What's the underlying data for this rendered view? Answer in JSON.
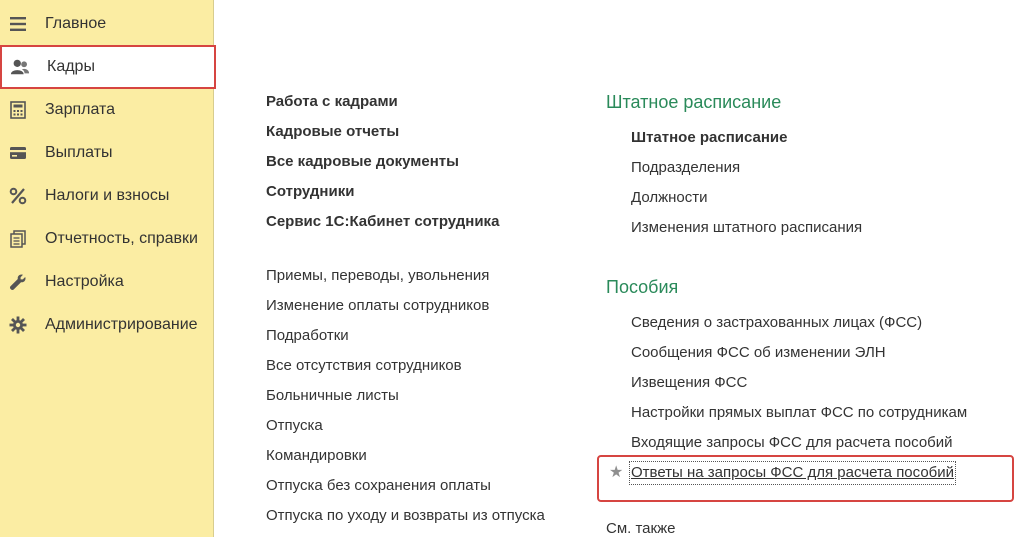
{
  "sidebar": {
    "items": [
      {
        "label": "Главное",
        "icon": "menu-lines-icon"
      },
      {
        "label": "Кадры",
        "icon": "users-icon"
      },
      {
        "label": "Зарплата",
        "icon": "calculator-icon"
      },
      {
        "label": "Выплаты",
        "icon": "wallet-icon"
      },
      {
        "label": "Налоги и взносы",
        "icon": "percent-icon"
      },
      {
        "label": "Отчетность, справки",
        "icon": "reports-icon"
      },
      {
        "label": "Настройка",
        "icon": "wrench-icon"
      },
      {
        "label": "Администрирование",
        "icon": "gear-icon"
      }
    ],
    "active_index": 1
  },
  "left_column": {
    "main_links": [
      "Работа с кадрами",
      "Кадровые отчеты",
      "Все кадровые документы",
      "Сотрудники",
      "Сервис 1С:Кабинет сотрудника"
    ],
    "links": [
      "Приемы, переводы, увольнения",
      "Изменение оплаты сотрудников",
      "Подработки",
      "Все отсутствия сотрудников",
      "Больничные листы",
      "Отпуска",
      "Командировки",
      "Отпуска без сохранения оплаты",
      "Отпуска по уходу и возвраты из отпуска"
    ]
  },
  "right_column": {
    "staffing": {
      "title": "Штатное расписание",
      "links": [
        "Штатное расписание",
        "Подразделения",
        "Должности",
        "Изменения штатного расписания"
      ]
    },
    "benefits": {
      "title": "Пособия",
      "links": [
        "Сведения о застрахованных лицах (ФСС)",
        "Сообщения ФСС об изменении ЭЛН",
        "Извещения ФСС",
        "Настройки прямых выплат ФСС по сотрудникам",
        "Входящие запросы ФСС для расчета пособий"
      ],
      "favorite_link": "Ответы на запросы ФСС для расчета пособий"
    },
    "see_also": "См. также"
  },
  "colors": {
    "sidebar_bg": "#fbeda3",
    "section_title": "#2a8a5a",
    "highlight_border": "#d64541"
  }
}
